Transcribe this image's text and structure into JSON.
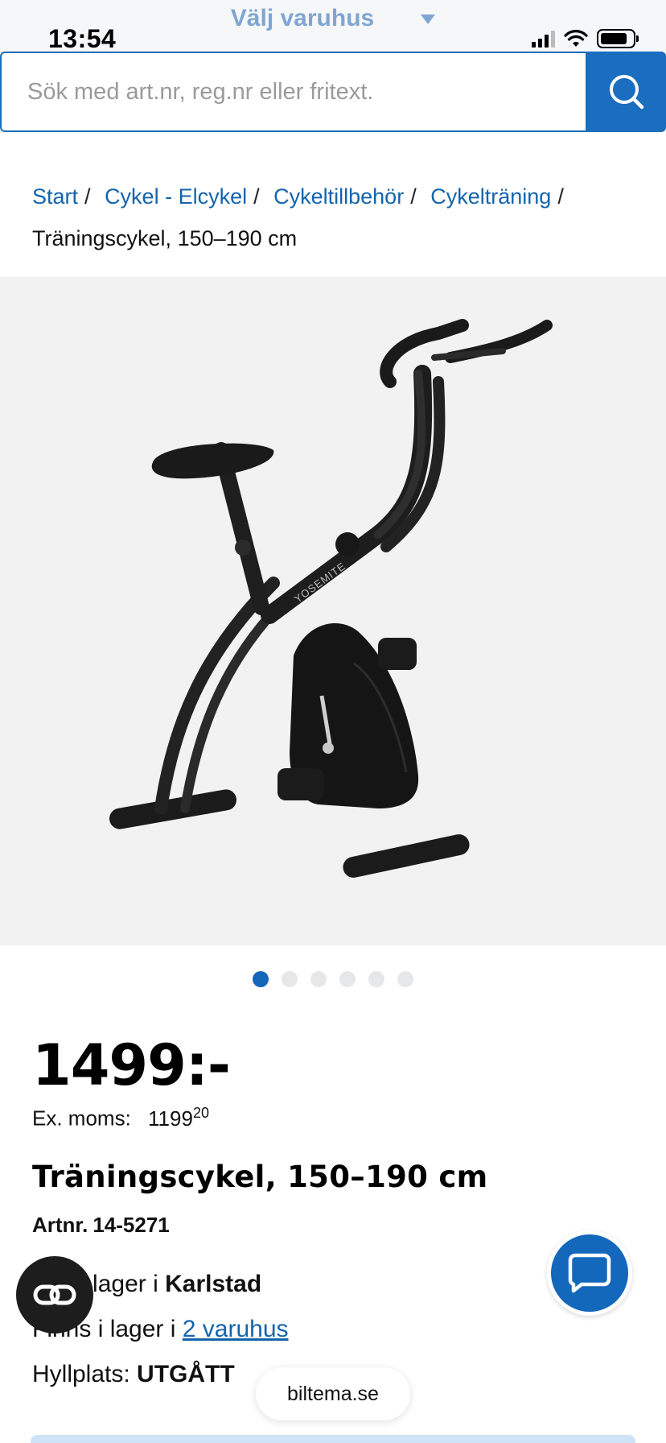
{
  "status_bar": {
    "time": "13:54",
    "store_selector": "Välj varuhus"
  },
  "search": {
    "placeholder": "Sök med art.nr, reg.nr eller fritext."
  },
  "breadcrumb": {
    "items": [
      "Start",
      "Cykel - Elcykel",
      "Cykeltillbehör",
      "Cykelträning"
    ],
    "separator": "/",
    "current": "Träningscykel, 150–190 cm"
  },
  "product_image": {
    "brand_on_frame": "YOSEMITE"
  },
  "carousel": {
    "total_images": 6,
    "active_index": 0
  },
  "product": {
    "price": "1499:-",
    "ex_moms_label": "Ex. moms:",
    "ex_moms_value": "1199",
    "ex_moms_decimals": "20",
    "title": "Träningscykel, 150–190 cm",
    "artnr_label": "Artnr.",
    "artnr_value": "14-5271"
  },
  "stock": {
    "line1_prefix": "Slut i lager i",
    "line1_store": "Karlstad",
    "line2_prefix": "Finns i lager i",
    "line2_link": "2 varuhus",
    "line3_label": "Hyllplats:",
    "line3_value": "UTGÅTT"
  },
  "footer": {
    "domain": "biltema.se"
  },
  "colors": {
    "brand_blue": "#1a6dbf",
    "link_blue": "#1464ad"
  }
}
